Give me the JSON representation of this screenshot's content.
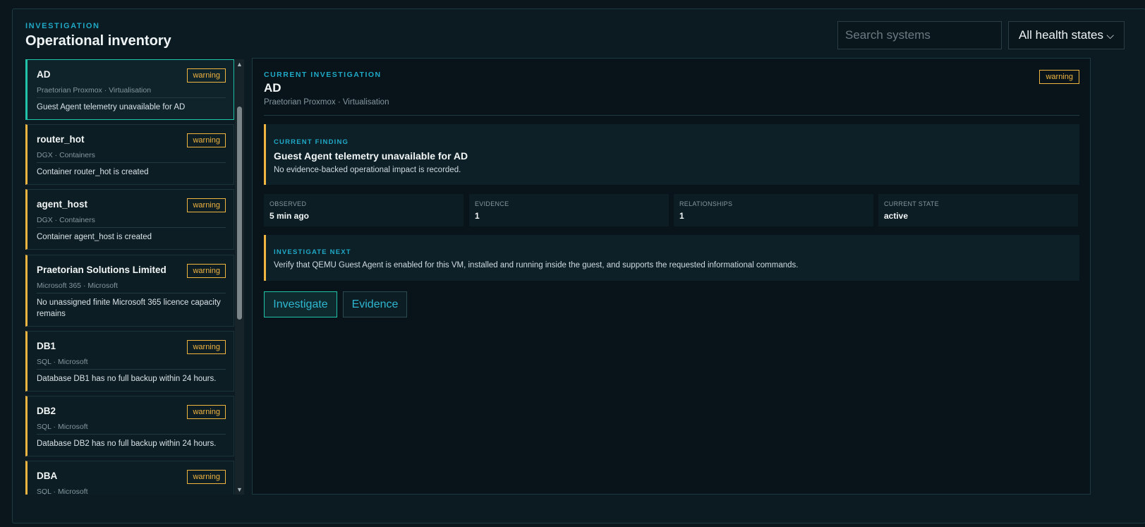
{
  "header": {
    "eyebrow": "INVESTIGATION",
    "title": "Operational inventory",
    "search_placeholder": "Search systems",
    "health_filter": "All health states"
  },
  "systems": [
    {
      "name": "AD",
      "badge": "warning",
      "sub": "Praetorian Proxmox · Virtualisation",
      "desc": "Guest Agent telemetry unavailable for AD",
      "selected": true
    },
    {
      "name": "router_hot",
      "badge": "warning",
      "sub": "DGX · Containers",
      "desc": "Container router_hot is created"
    },
    {
      "name": "agent_host",
      "badge": "warning",
      "sub": "DGX · Containers",
      "desc": "Container agent_host is created"
    },
    {
      "name": "Praetorian Solutions Limited",
      "badge": "warning",
      "sub": "Microsoft 365 · Microsoft",
      "desc": "No unassigned finite Microsoft 365 licence capacity remains"
    },
    {
      "name": "DB1",
      "badge": "warning",
      "sub": "SQL · Microsoft",
      "desc": "Database DB1 has no full backup within 24 hours."
    },
    {
      "name": "DB2",
      "badge": "warning",
      "sub": "SQL · Microsoft",
      "desc": "Database DB2 has no full backup within 24 hours."
    },
    {
      "name": "DBA",
      "badge": "warning",
      "sub": "SQL · Microsoft",
      "desc": ""
    }
  ],
  "detail": {
    "eyebrow": "CURRENT INVESTIGATION",
    "title": "AD",
    "sub": "Praetorian Proxmox · Virtualisation",
    "badge": "warning",
    "finding": {
      "label": "CURRENT FINDING",
      "headline": "Guest Agent telemetry unavailable for AD",
      "text": "No evidence-backed operational impact is recorded."
    },
    "stats": [
      {
        "label": "OBSERVED",
        "value": "5 min ago"
      },
      {
        "label": "EVIDENCE",
        "value": "1"
      },
      {
        "label": "RELATIONSHIPS",
        "value": "1"
      },
      {
        "label": "CURRENT STATE",
        "value": "active"
      }
    ],
    "next": {
      "label": "INVESTIGATE NEXT",
      "text": "Verify that QEMU Guest Agent is enabled for this VM, installed and running inside the guest, and supports the requested informational commands."
    },
    "actions": {
      "investigate": "Investigate",
      "evidence": "Evidence"
    }
  },
  "colors": {
    "accent": "#20a9c7",
    "warning": "#f0b440",
    "selected": "#21c4a8"
  }
}
